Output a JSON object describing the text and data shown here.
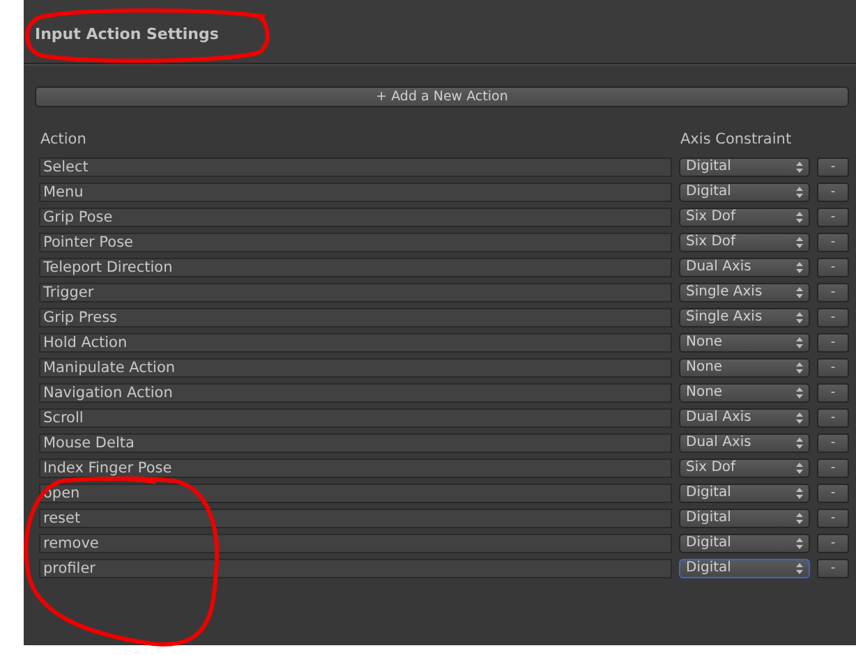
{
  "title": "Input Action Settings",
  "add_button": "+ Add a New Action",
  "columns": [
    "Action",
    "Axis Constraint"
  ],
  "actions": [
    {
      "name": "Select",
      "constraint": "Digital",
      "focused": false
    },
    {
      "name": "Menu",
      "constraint": "Digital",
      "focused": false
    },
    {
      "name": "Grip Pose",
      "constraint": "Six Dof",
      "focused": false
    },
    {
      "name": "Pointer Pose",
      "constraint": "Six Dof",
      "focused": false
    },
    {
      "name": "Teleport Direction",
      "constraint": "Dual Axis",
      "focused": false
    },
    {
      "name": "Trigger",
      "constraint": "Single Axis",
      "focused": false
    },
    {
      "name": "Grip Press",
      "constraint": "Single Axis",
      "focused": false
    },
    {
      "name": "Hold Action",
      "constraint": "None",
      "focused": false
    },
    {
      "name": "Manipulate Action",
      "constraint": "None",
      "focused": false
    },
    {
      "name": "Navigation Action",
      "constraint": "None",
      "focused": false
    },
    {
      "name": "Scroll",
      "constraint": "Dual Axis",
      "focused": false
    },
    {
      "name": "Mouse Delta",
      "constraint": "Dual Axis",
      "focused": false
    },
    {
      "name": "Index Finger Pose",
      "constraint": "Six Dof",
      "focused": false
    },
    {
      "name": "open",
      "constraint": "Digital",
      "focused": false
    },
    {
      "name": "reset",
      "constraint": "Digital",
      "focused": false
    },
    {
      "name": "remove",
      "constraint": "Digital",
      "focused": false
    },
    {
      "name": "profiler",
      "constraint": "Digital",
      "focused": true
    }
  ],
  "remove_label": "-"
}
